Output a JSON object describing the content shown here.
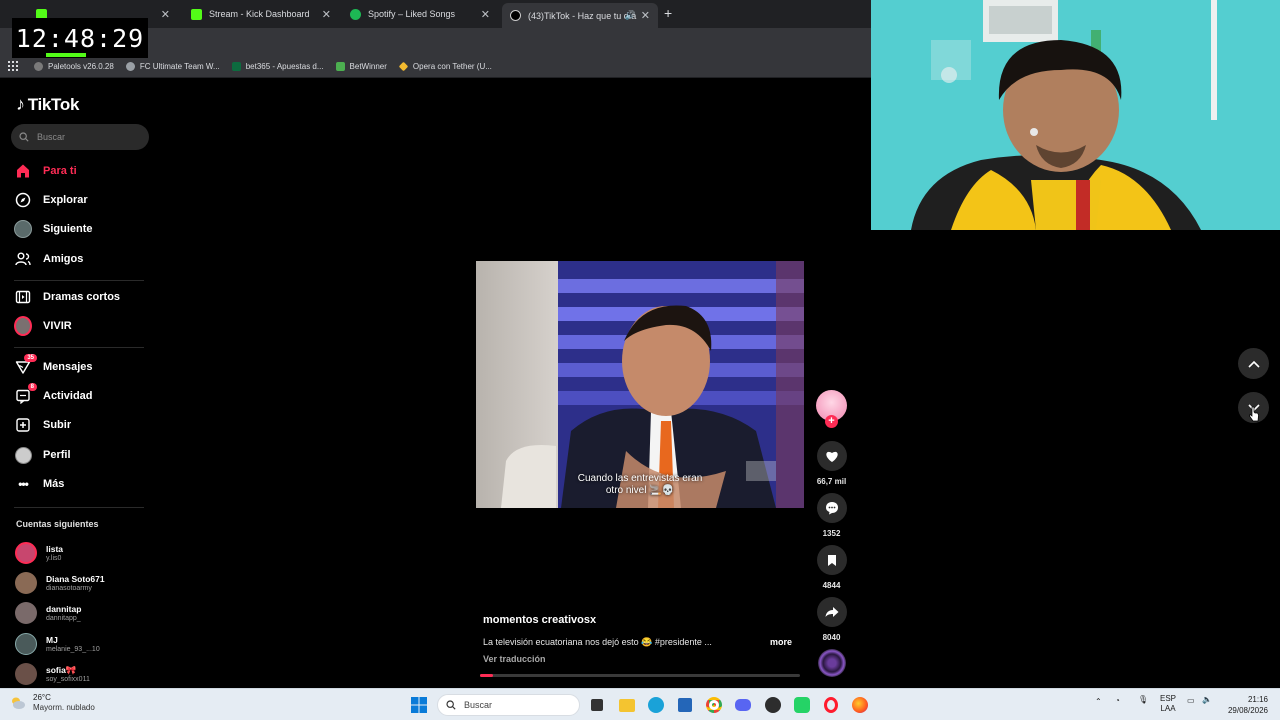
{
  "overlay_timer": "12:48:29",
  "browser": {
    "tabs": [
      {
        "label": "",
        "active": false,
        "color": "#53fc18"
      },
      {
        "label": "Stream - Kick Dashboard",
        "active": false,
        "color": "#53fc18"
      },
      {
        "label": "Spotify – Liked Songs",
        "active": false,
        "color": "#1db954"
      },
      {
        "label": "(43)TikTok - Haz que tu día",
        "active": true,
        "color": "#ffffff"
      }
    ],
    "bookmarks": [
      {
        "label": "Paletools v26.0.28",
        "color": "#7a7a7a"
      },
      {
        "label": "FC Ultimate Team W...",
        "color": "#9aa0a6"
      },
      {
        "label": "bet365 - Apuestas d...",
        "color": "#0d6b3f"
      },
      {
        "label": "BetWinner",
        "color": "#4caf50"
      },
      {
        "label": "Opera con Tether (U...",
        "color": "#f3ba2f"
      }
    ]
  },
  "tiktok": {
    "logo": "TikTok",
    "search_placeholder": "Buscar",
    "nav": [
      {
        "label": "Para ti",
        "icon": "home-icon",
        "active": true
      },
      {
        "label": "Explorar",
        "icon": "compass-icon"
      },
      {
        "label": "Siguiente",
        "icon": "avatar-icon"
      },
      {
        "label": "Amigos",
        "icon": "friends-icon"
      },
      {
        "label": "Dramas cortos",
        "icon": "film-icon"
      },
      {
        "label": "VIVIR",
        "icon": "live-icon"
      },
      {
        "label": "Mensajes",
        "icon": "messages-icon",
        "badge": "35"
      },
      {
        "label": "Actividad",
        "icon": "activity-icon",
        "badge": "8"
      },
      {
        "label": "Subir",
        "icon": "upload-icon"
      },
      {
        "label": "Perfil",
        "icon": "profile-icon"
      },
      {
        "label": "Más",
        "icon": "more-icon"
      }
    ],
    "following_title": "Cuentas siguientes",
    "following": [
      {
        "name": "lista",
        "username": "y.lis0",
        "color": "#c8466e"
      },
      {
        "name": "Diana Soto671",
        "username": "dianasotoarmy",
        "color": "#8a6a55"
      },
      {
        "name": "dannitap",
        "username": "dannitapp_",
        "color": "#7a6a6a"
      },
      {
        "name": "MJ",
        "username": "melanie_93_...10",
        "color": "#4a5a5a"
      },
      {
        "name": "sofia🎀",
        "username": "soy_sofixx011",
        "color": "#6a5048"
      }
    ],
    "video": {
      "caption_line1": "Cuando las entrevistas eran",
      "caption_line2": "otro nivel 🚬💀",
      "author": "momentos creativosx",
      "description": "La televisión ecuatoriana nos dejó esto 😂 #presidente ...",
      "more": "more",
      "translate": "Ver traducción",
      "progress": 0.04
    },
    "actions": {
      "likes": "66,7 mil",
      "comments": "1352",
      "saves": "4844",
      "shares": "8040"
    }
  },
  "taskbar": {
    "temperature": "26°C",
    "condition": "Mayorm. nublado",
    "search": "Buscar",
    "lang_top": "ESP",
    "lang_bottom": "LAA",
    "time": "21:16",
    "date": "29/08/2026"
  }
}
